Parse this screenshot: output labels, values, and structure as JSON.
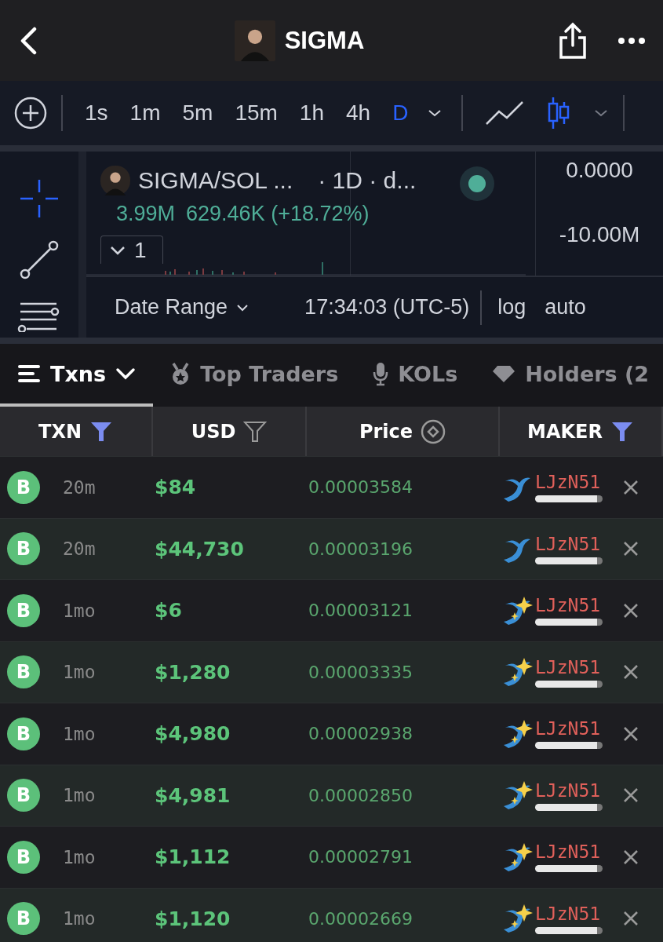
{
  "header": {
    "title": "SIGMA"
  },
  "toolbar": {
    "intervals": [
      {
        "label": "1s",
        "selected": false
      },
      {
        "label": "1m",
        "selected": false
      },
      {
        "label": "5m",
        "selected": false
      },
      {
        "label": "15m",
        "selected": false
      },
      {
        "label": "1h",
        "selected": false
      },
      {
        "label": "4h",
        "selected": false
      },
      {
        "label": "D",
        "selected": true
      }
    ],
    "chart_types": [
      {
        "kind": "line",
        "selected": false
      },
      {
        "kind": "candles",
        "selected": true
      }
    ]
  },
  "chart": {
    "tools": [
      {
        "kind": "crosshair",
        "selected": true
      },
      {
        "kind": "trend_line",
        "selected": false
      },
      {
        "kind": "indicators",
        "selected": false
      }
    ],
    "symbol": "SIGMA/SOL ...",
    "interval": "· 1D · d...",
    "volume": "3.99M",
    "volume_change": "629.46K (+18.72%)",
    "indicator_count": "1",
    "price_labels": [
      "0.0000",
      "-10.00M"
    ],
    "date_range": "Date Range",
    "time": "17:34:03 (UTC-5)",
    "log": "log",
    "auto": "auto"
  },
  "tabs": [
    {
      "label": "Txns",
      "kind": "list",
      "selected": true
    },
    {
      "label": "Top Traders",
      "kind": "medal",
      "selected": false
    },
    {
      "label": "KOLs",
      "kind": "mic",
      "selected": false
    },
    {
      "label": "Holders (2",
      "kind": "diamond",
      "selected": false
    }
  ],
  "columns": [
    {
      "label": "TXN",
      "kind": "filter",
      "active": true
    },
    {
      "label": "USD",
      "kind": "filter",
      "active": false
    },
    {
      "label": "Price",
      "kind": "sort",
      "active": false
    },
    {
      "label": "MAKER",
      "kind": "filter",
      "active": true
    }
  ],
  "rows": [
    {
      "type": "B",
      "age": "20m",
      "usd": "$84",
      "price": "0.00003584",
      "maker": "LJzN51",
      "kind": "whale"
    },
    {
      "type": "B",
      "age": "20m",
      "usd": "$44,730",
      "price": "0.00003196",
      "maker": "LJzN51",
      "kind": "whale"
    },
    {
      "type": "B",
      "age": "1mo",
      "usd": "$6",
      "price": "0.00003121",
      "maker": "LJzN51",
      "kind": "new_whale"
    },
    {
      "type": "B",
      "age": "1mo",
      "usd": "$1,280",
      "price": "0.00003335",
      "maker": "LJzN51",
      "kind": "new_whale"
    },
    {
      "type": "B",
      "age": "1mo",
      "usd": "$4,980",
      "price": "0.00002938",
      "maker": "LJzN51",
      "kind": "new_whale"
    },
    {
      "type": "B",
      "age": "1mo",
      "usd": "$4,981",
      "price": "0.00002850",
      "maker": "LJzN51",
      "kind": "new_whale"
    },
    {
      "type": "B",
      "age": "1mo",
      "usd": "$1,112",
      "price": "0.00002791",
      "maker": "LJzN51",
      "kind": "new_whale"
    },
    {
      "type": "B",
      "age": "1mo",
      "usd": "$1,120",
      "price": "0.00002669",
      "maker": "LJzN51",
      "kind": "new_whale"
    }
  ]
}
